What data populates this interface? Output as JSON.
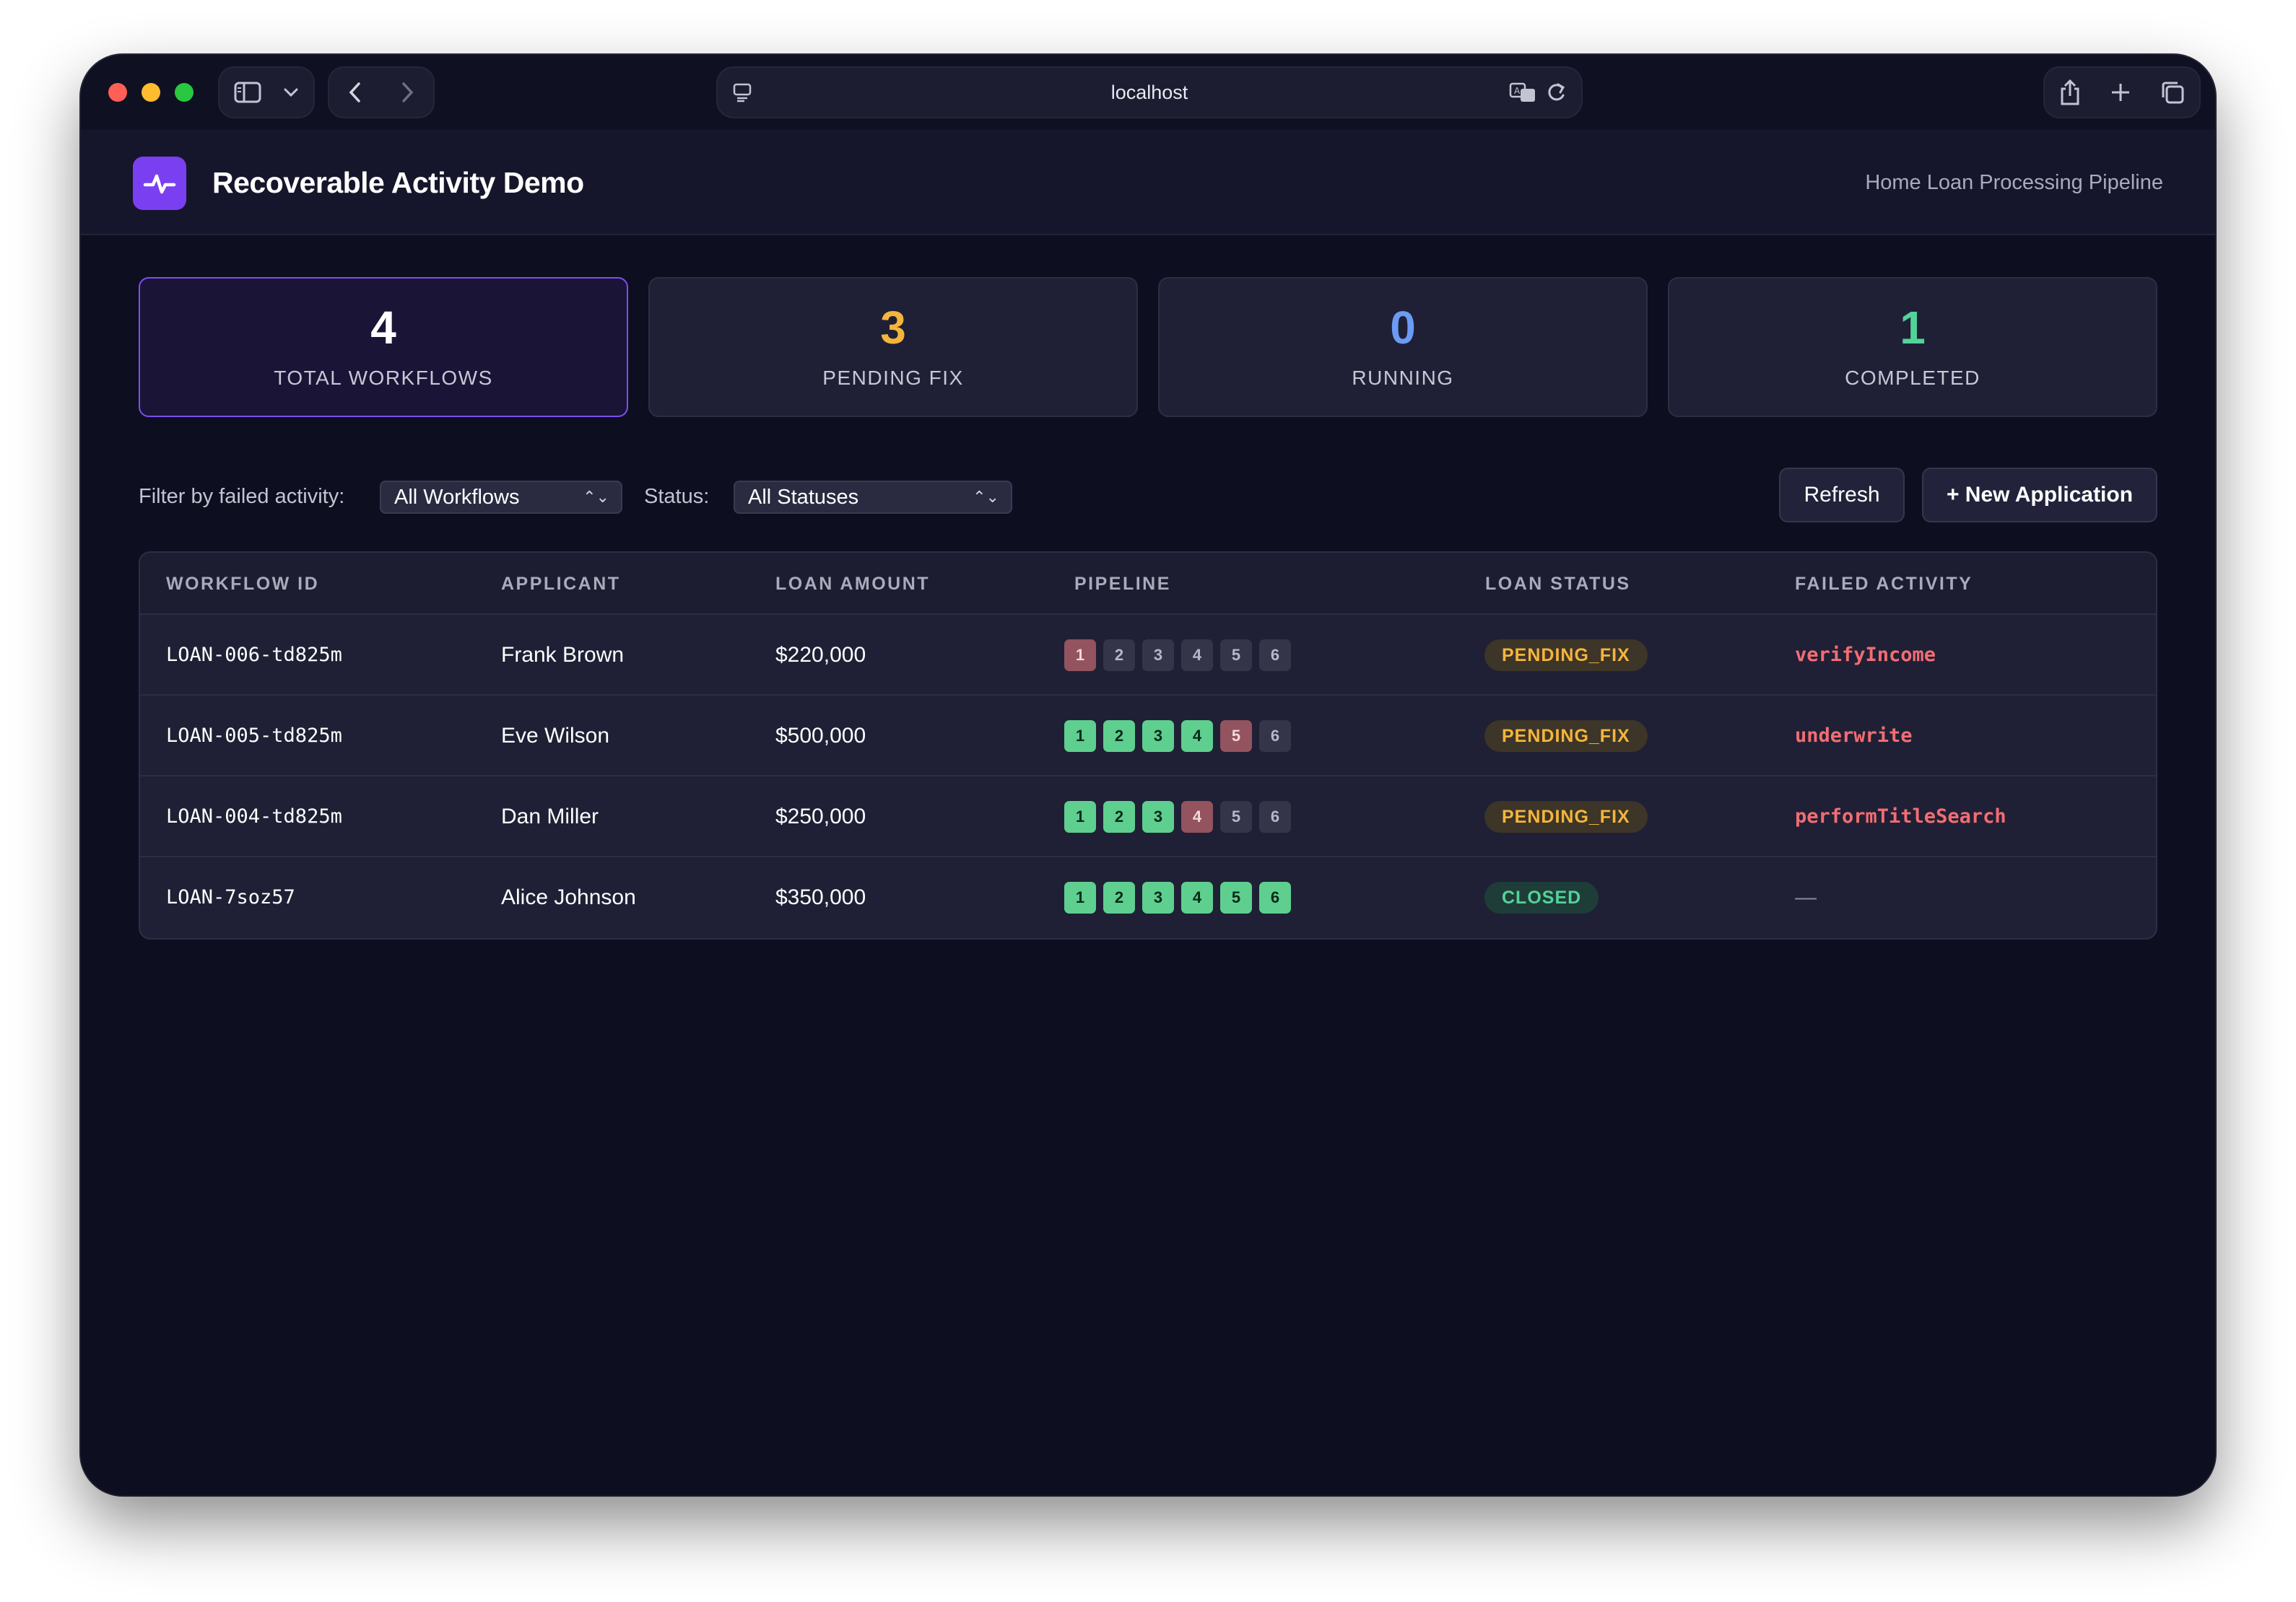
{
  "browser": {
    "address": "localhost"
  },
  "app": {
    "title": "Recoverable Activity Demo",
    "subtitle": "Home Loan Processing Pipeline"
  },
  "stats": [
    {
      "value": "4",
      "label": "TOTAL WORKFLOWS",
      "color": "#ffffff"
    },
    {
      "value": "3",
      "label": "PENDING FIX",
      "color": "#f5b53c"
    },
    {
      "value": "0",
      "label": "RUNNING",
      "color": "#6a9bf5"
    },
    {
      "value": "1",
      "label": "COMPLETED",
      "color": "#52d39a"
    }
  ],
  "filters": {
    "failed_activity_label": "Filter by failed activity:",
    "failed_activity_value": "All Workflows",
    "status_label": "Status:",
    "status_value": "All Statuses",
    "refresh_label": "Refresh",
    "new_application_label": "+ New Application"
  },
  "table": {
    "headers": {
      "workflow_id": "WORKFLOW ID",
      "applicant": "APPLICANT",
      "loan_amount": "LOAN AMOUNT",
      "pipeline": "PIPELINE",
      "loan_status": "LOAN STATUS",
      "failed_activity": "FAILED ACTIVITY"
    },
    "rows": [
      {
        "workflow_id": "LOAN-006-td825m",
        "applicant": "Frank Brown",
        "loan_amount": "$220,000",
        "pipeline": [
          {
            "n": "1",
            "state": "fail"
          },
          {
            "n": "2",
            "state": "pending"
          },
          {
            "n": "3",
            "state": "pending"
          },
          {
            "n": "4",
            "state": "pending"
          },
          {
            "n": "5",
            "state": "pending"
          },
          {
            "n": "6",
            "state": "pending"
          }
        ],
        "loan_status": "PENDING_FIX",
        "status_kind": "pending",
        "failed_activity": "verifyIncome"
      },
      {
        "workflow_id": "LOAN-005-td825m",
        "applicant": "Eve Wilson",
        "loan_amount": "$500,000",
        "pipeline": [
          {
            "n": "1",
            "state": "done"
          },
          {
            "n": "2",
            "state": "done"
          },
          {
            "n": "3",
            "state": "done"
          },
          {
            "n": "4",
            "state": "done"
          },
          {
            "n": "5",
            "state": "fail"
          },
          {
            "n": "6",
            "state": "pending"
          }
        ],
        "loan_status": "PENDING_FIX",
        "status_kind": "pending",
        "failed_activity": "underwrite"
      },
      {
        "workflow_id": "LOAN-004-td825m",
        "applicant": "Dan Miller",
        "loan_amount": "$250,000",
        "pipeline": [
          {
            "n": "1",
            "state": "done"
          },
          {
            "n": "2",
            "state": "done"
          },
          {
            "n": "3",
            "state": "done"
          },
          {
            "n": "4",
            "state": "fail"
          },
          {
            "n": "5",
            "state": "pending"
          },
          {
            "n": "6",
            "state": "pending"
          }
        ],
        "loan_status": "PENDING_FIX",
        "status_kind": "pending",
        "failed_activity": "performTitleSearch"
      },
      {
        "workflow_id": "LOAN-7soz57",
        "applicant": "Alice Johnson",
        "loan_amount": "$350,000",
        "pipeline": [
          {
            "n": "1",
            "state": "done"
          },
          {
            "n": "2",
            "state": "done"
          },
          {
            "n": "3",
            "state": "done"
          },
          {
            "n": "4",
            "state": "done"
          },
          {
            "n": "5",
            "state": "done"
          },
          {
            "n": "6",
            "state": "done"
          }
        ],
        "loan_status": "CLOSED",
        "status_kind": "closed",
        "failed_activity": "—"
      }
    ]
  }
}
